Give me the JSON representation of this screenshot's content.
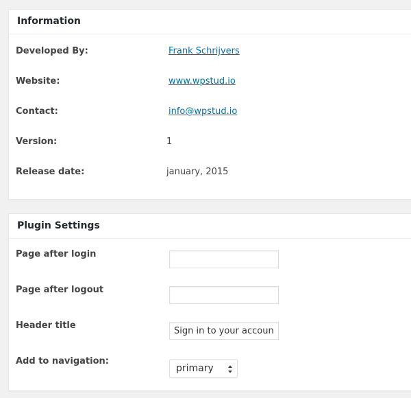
{
  "information": {
    "title": "Information",
    "rows": [
      {
        "label": "Developed By:",
        "value": "Frank Schrijvers",
        "link": true
      },
      {
        "label": "Website:",
        "value": "www.wpstud.io",
        "link": true
      },
      {
        "label": "Contact:",
        "value": "info@wpstud.io",
        "link": true
      },
      {
        "label": "Version:",
        "value": "1",
        "link": false
      },
      {
        "label": "Release date:",
        "value": "january, 2015",
        "link": false
      }
    ]
  },
  "settings": {
    "title": "Plugin Settings",
    "page_after_login": {
      "label": "Page after login",
      "value": ""
    },
    "page_after_logout": {
      "label": "Page after logout",
      "value": ""
    },
    "header_title": {
      "label": "Header title",
      "value": "Sign in to your account"
    },
    "add_to_navigation": {
      "label": "Add to navigation:",
      "selected": "primary"
    }
  },
  "colors": {
    "link": "#0073aa",
    "panel_bg": "#ffffff",
    "page_bg": "#f1f1f1"
  },
  "icons": {
    "select_arrows": "up-down-chevron-icon"
  }
}
